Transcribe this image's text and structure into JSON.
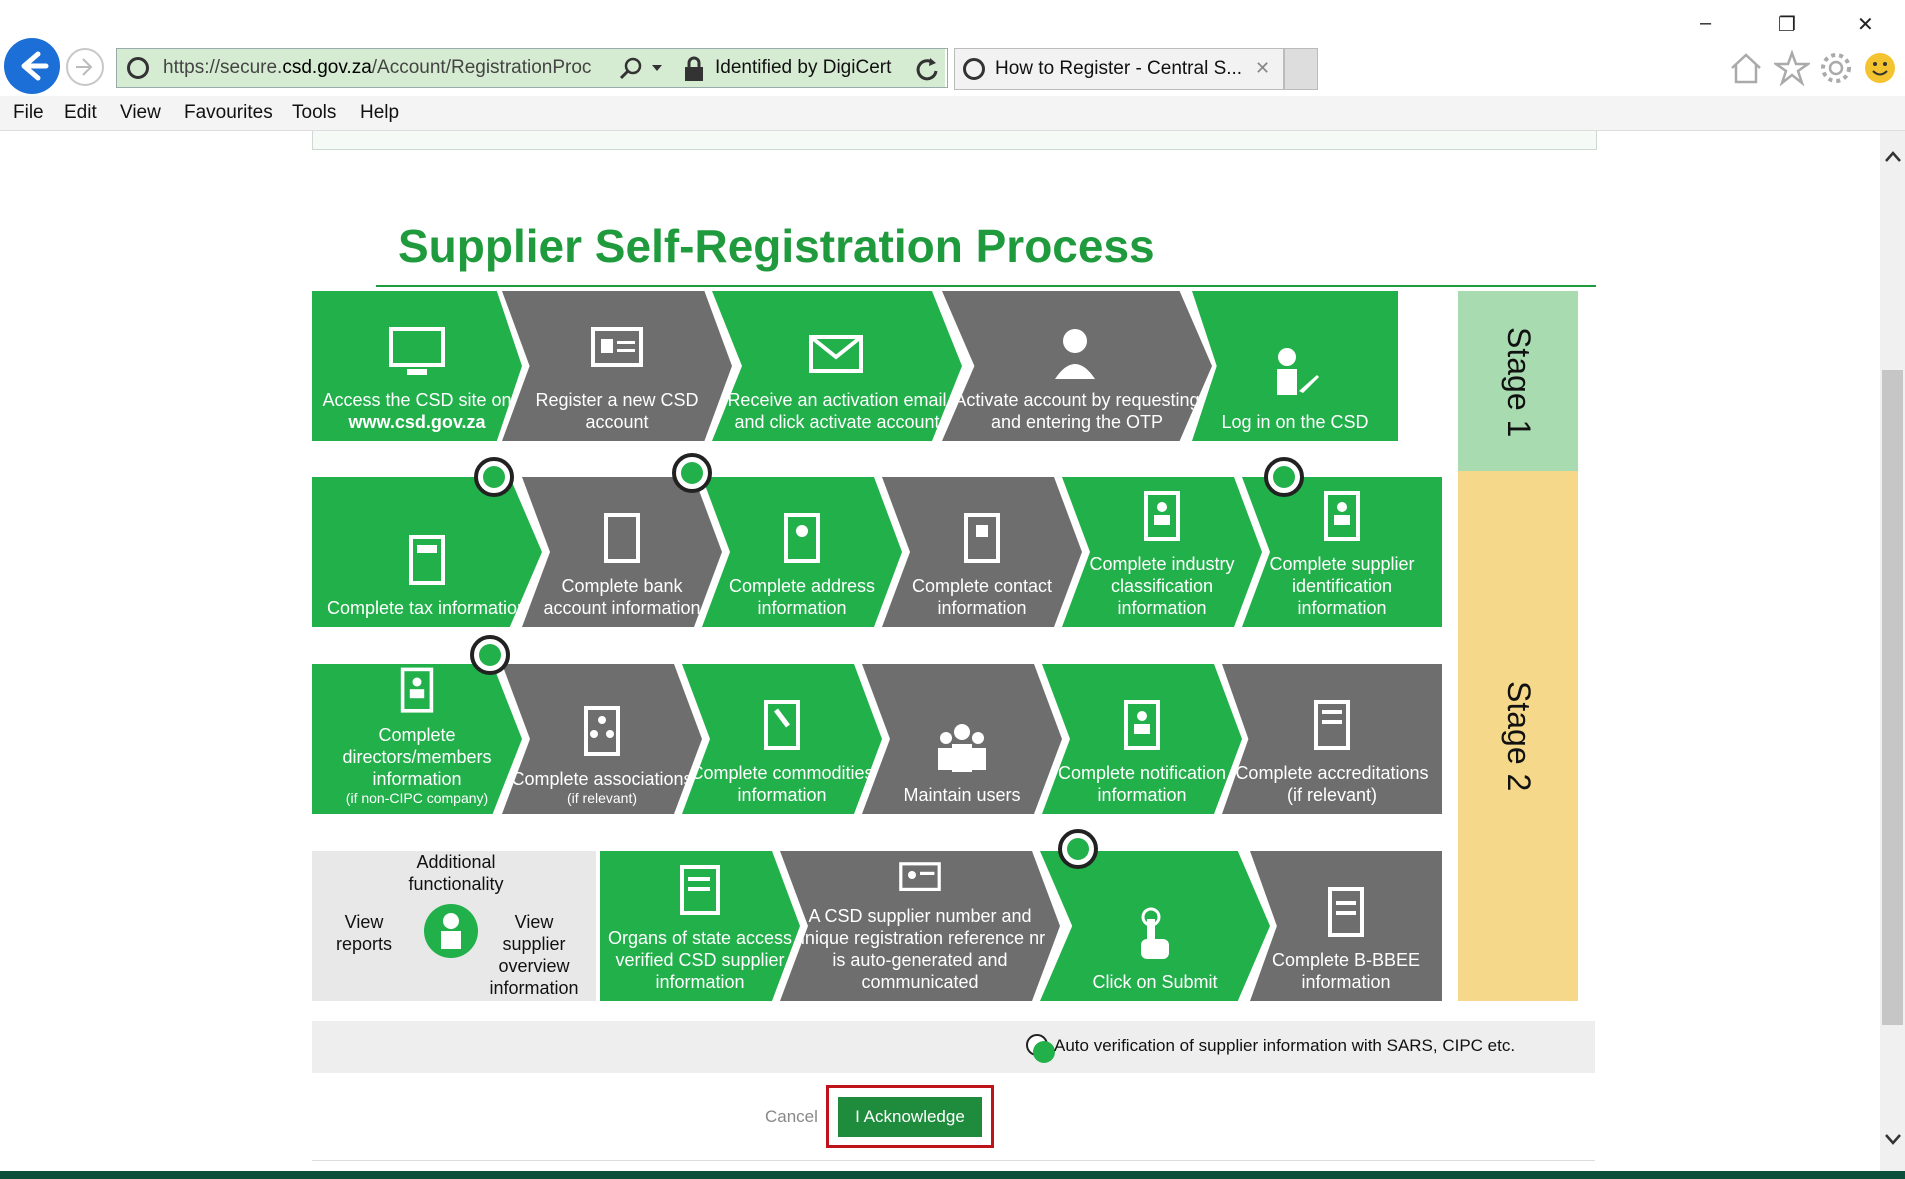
{
  "window": {
    "minimize": "–",
    "restore": "❐",
    "close": "✕"
  },
  "nav": {
    "url_prefix": "https://secure.",
    "url_domain": "csd.gov.za",
    "url_path": "/Account/RegistrationProc",
    "security": "Identified by DigiCert"
  },
  "tab": {
    "title": "How to Register - Central S...",
    "close": "✕"
  },
  "menu": [
    "File",
    "Edit",
    "View",
    "Favourites",
    "Tools",
    "Help"
  ],
  "page": {
    "title": "Supplier Self-Registration Process",
    "stage1": "Stage 1",
    "stage2": "Stage 2",
    "rows": {
      "r1": [
        "Access the CSD site on",
        "www.csd.gov.za",
        "Register a new CSD account",
        "Receive an activation email and click activate account",
        "Activate account by requesting and entering the OTP",
        "Log in on the CSD"
      ],
      "r2": [
        "Complete tax information",
        "Complete bank account information",
        "Complete address information",
        "Complete contact information",
        "Complete industry classification information",
        "Complete supplier identification information"
      ],
      "r3": [
        "Complete directors/members information",
        "(if non-CIPC company)",
        "Complete associations",
        "(if relevant)",
        "Complete commodities information",
        "Maintain users",
        "Complete notification information",
        "Complete accreditations (if relevant)"
      ],
      "r4": [
        "Additional functionality",
        "View reports",
        "View supplier overview information",
        "Organs of state access verified CSD supplier information",
        "A CSD supplier number and unique registration reference nr is auto-generated and communicated",
        "Click on Submit",
        "Complete B-BBEE information"
      ]
    },
    "auto_note": "Auto verification  of supplier information  with SARS, CIPC etc.",
    "cancel": "Cancel",
    "acknowledge": "I Acknowledge"
  },
  "colors": {
    "green": "#22b04b",
    "grey": "#6e6e6e",
    "stage1": "#a8dbb0",
    "stage2": "#f5d889",
    "accent": "#c0121b"
  }
}
